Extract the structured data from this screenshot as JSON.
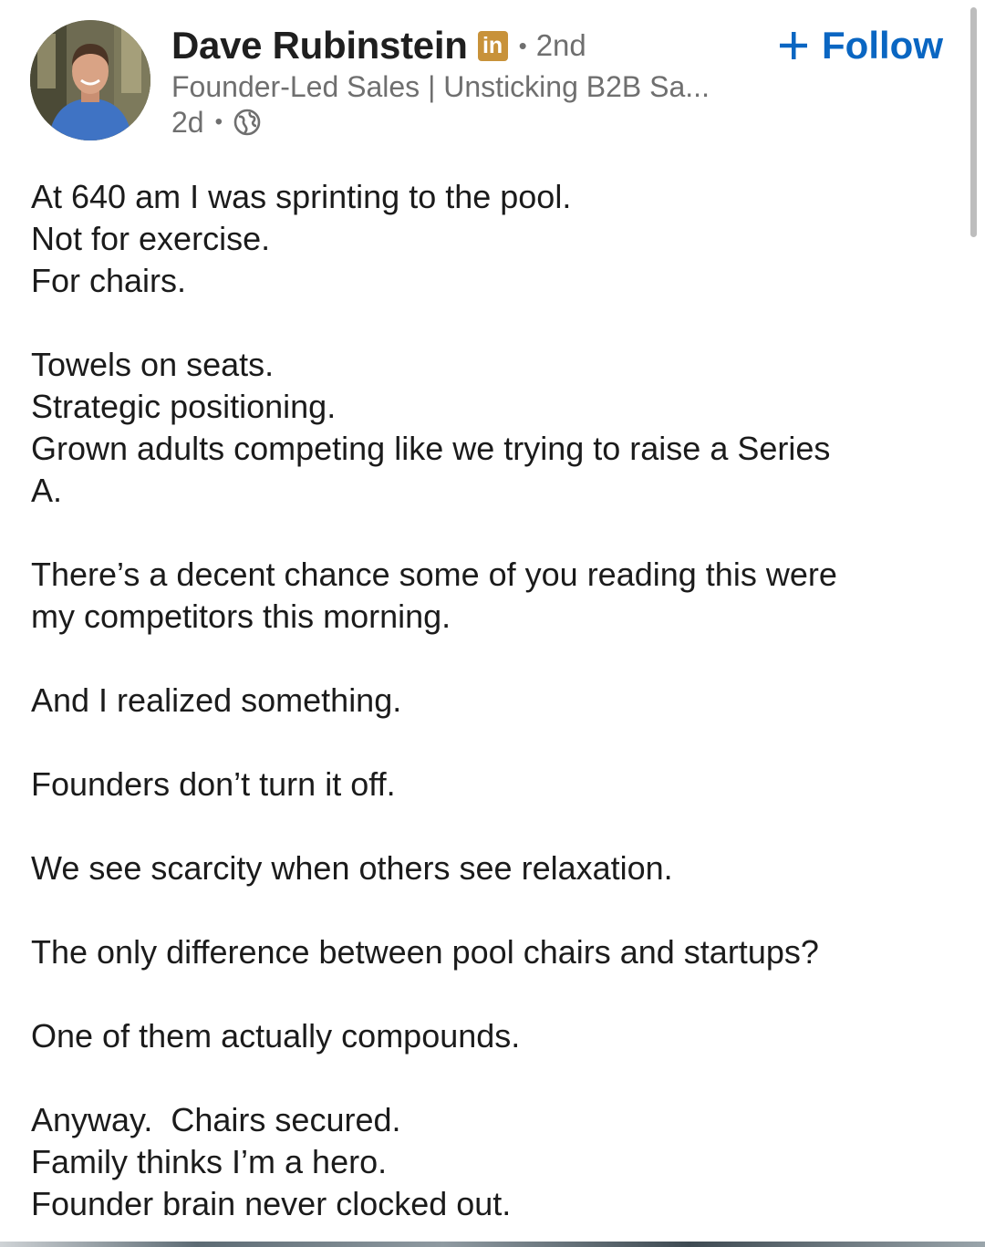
{
  "author": {
    "name": "Dave Rubinstein",
    "badge": "in",
    "degree": "2nd",
    "headline": "Founder-Led Sales | Unsticking B2B Sa...",
    "time": "2d",
    "visibility_icon": "globe-icon",
    "avatar_icon": "profile-photo"
  },
  "actions": {
    "follow_label": "Follow",
    "follow_icon": "plus-icon"
  },
  "separator": "•",
  "colors": {
    "accent": "#0a66c2",
    "badge": "#c8923a",
    "secondary_text": "#6f6f6f",
    "body_text": "#1b1b1b"
  },
  "post": {
    "paragraphs": [
      [
        "At 640 am I was sprinting to the pool.",
        "Not for exercise.",
        "For chairs."
      ],
      [
        "Towels on seats.",
        "Strategic positioning.",
        "Grown adults competing like we trying to raise a Series",
        "A."
      ],
      [
        "There’s a decent chance some of you reading this were",
        "my competitors this morning."
      ],
      [
        "And I realized something."
      ],
      [
        "Founders don’t turn it off."
      ],
      [
        "We see scarcity when others see relaxation."
      ],
      [
        "The only difference between pool chairs and startups?"
      ],
      [
        "One of them actually compounds."
      ],
      [
        "Anyway.  Chairs secured.",
        "Family thinks I’m a hero.",
        "Founder brain never clocked out."
      ]
    ]
  }
}
